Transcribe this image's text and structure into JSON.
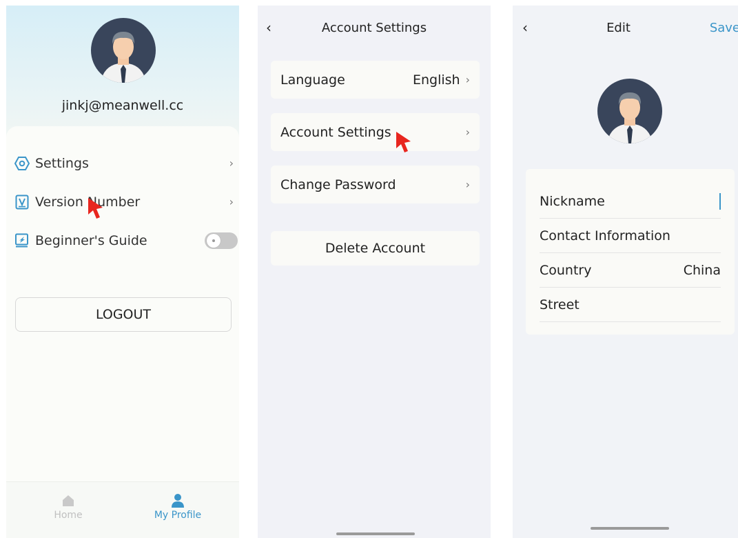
{
  "colors": {
    "accent": "#3a95c9",
    "cursor": "#e8261f",
    "avatar_bg": "#39455b"
  },
  "profile_screen": {
    "email": "jinkj@meanwell.cc",
    "menu": {
      "settings": {
        "label": "Settings",
        "icon": "settings-hexagon-icon"
      },
      "version": {
        "label": "Version Number",
        "icon": "version-icon"
      },
      "guide": {
        "label": "Beginner's Guide",
        "icon": "guide-book-icon",
        "toggle_on": false
      }
    },
    "logout_label": "LOGOUT",
    "tabs": {
      "home": {
        "label": "Home",
        "icon": "home-icon",
        "active": false
      },
      "profile": {
        "label": "My Profile",
        "icon": "person-icon",
        "active": true
      }
    }
  },
  "account_screen": {
    "title": "Account Settings",
    "back_icon": "chevron-left-icon",
    "rows": {
      "language": {
        "label": "Language",
        "value": "English"
      },
      "account": {
        "label": "Account Settings"
      },
      "password": {
        "label": "Change Password"
      }
    },
    "delete_label": "Delete Account"
  },
  "edit_screen": {
    "title": "Edit",
    "save_label": "Save",
    "fields": {
      "nickname": {
        "label": "Nickname",
        "value": ""
      },
      "contact": {
        "label": "Contact Information",
        "value": ""
      },
      "country": {
        "label": "Country",
        "value": "China"
      },
      "street": {
        "label": "Street",
        "value": ""
      }
    }
  }
}
